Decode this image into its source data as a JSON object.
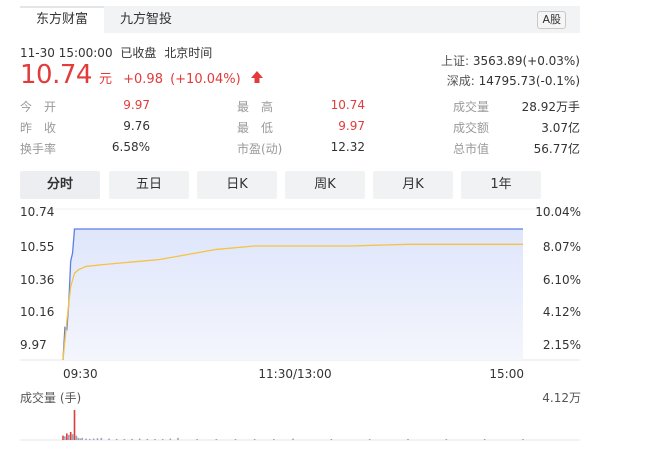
{
  "tabs": [
    {
      "label": "东方财富",
      "active": true
    },
    {
      "label": "九方智投",
      "active": false
    }
  ],
  "market_badge": "A股",
  "quote": {
    "timestamp": "11-30 15:00:00",
    "status": "已收盘",
    "timezone": "北京时间",
    "price": "10.74",
    "unit": "元",
    "change": "+0.98",
    "change_pct": "(+10.04%)"
  },
  "indices": [
    {
      "label": "上证:",
      "value": "3563.89(+0.03%)"
    },
    {
      "label": "深成:",
      "value": "14795.73(-0.1%)"
    }
  ],
  "stats": {
    "col1": [
      {
        "label": "今　开",
        "value": "9.97",
        "red": true
      },
      {
        "label": "昨　收",
        "value": "9.76",
        "red": false
      },
      {
        "label": "换手率",
        "value": "6.58%",
        "red": false
      }
    ],
    "col2": [
      {
        "label": "最　高",
        "value": "10.74",
        "red": true
      },
      {
        "label": "最　低",
        "value": "9.97",
        "red": true
      },
      {
        "label": "市盈(动)",
        "value": "12.32",
        "red": false
      }
    ],
    "col3": [
      {
        "label": "成交量",
        "value": "28.92万手"
      },
      {
        "label": "成交额",
        "value": "3.07亿"
      },
      {
        "label": "总市值",
        "value": "56.77亿"
      }
    ]
  },
  "period_buttons": [
    {
      "label": "分时",
      "active": true
    },
    {
      "label": "五日",
      "active": false
    },
    {
      "label": "日K",
      "active": false
    },
    {
      "label": "周K",
      "active": false
    },
    {
      "label": "月K",
      "active": false
    },
    {
      "label": "1年",
      "active": false
    }
  ],
  "colors": {
    "up": "#e23b3b",
    "price_line": "#5b7ee8",
    "avg_line": "#f5c342",
    "area": "#dfe6fb"
  },
  "chart_data": {
    "type": "line",
    "y_left_ticks": [
      "10.74",
      "10.55",
      "10.36",
      "10.16",
      "9.97"
    ],
    "y_right_ticks": [
      "10.04%",
      "8.07%",
      "6.10%",
      "4.12%",
      "2.15%"
    ],
    "x_ticks": [
      "09:30",
      "11:30/13:00",
      "15:00"
    ],
    "ylim": [
      9.97,
      10.74
    ],
    "series": [
      {
        "key": "price",
        "x": [
          0,
          1,
          2,
          3,
          4,
          5,
          6,
          8,
          240
        ],
        "values": [
          9.97,
          10.16,
          10.15,
          10.3,
          10.55,
          10.6,
          10.74,
          10.74,
          10.74
        ]
      },
      {
        "key": "avg",
        "x": [
          0,
          2,
          4,
          6,
          8,
          12,
          20,
          30,
          40,
          50,
          60,
          80,
          100,
          120,
          150,
          180,
          200,
          220,
          240
        ],
        "values": [
          9.97,
          10.2,
          10.4,
          10.48,
          10.5,
          10.52,
          10.53,
          10.54,
          10.55,
          10.56,
          10.58,
          10.62,
          10.64,
          10.64,
          10.64,
          10.65,
          10.65,
          10.65,
          10.65
        ]
      }
    ],
    "volume_label": "成交量 (手)",
    "volume_max_label": "4.12万",
    "volume_ymax": 4.12,
    "volume": {
      "x": [
        0,
        1,
        2,
        3,
        4,
        5,
        6,
        7,
        8,
        9,
        10,
        12,
        14,
        16,
        18,
        20,
        24,
        28,
        32,
        36,
        40,
        44,
        48,
        52,
        56,
        60,
        70,
        80,
        90,
        100,
        110,
        120,
        140,
        160,
        180,
        200,
        220,
        240
      ],
      "values": [
        0.6,
        0.5,
        0.9,
        0.7,
        1.1,
        0.8,
        4.12,
        0.6,
        0.3,
        0.2,
        0.3,
        0.2,
        0.15,
        0.2,
        0.25,
        0.3,
        0.2,
        0.15,
        0.1,
        0.15,
        0.2,
        0.15,
        0.1,
        0.1,
        0.2,
        0.3,
        0.1,
        0.05,
        0.1,
        0.05,
        0.05,
        0.2,
        0.05,
        0.05,
        0.05,
        0.05,
        0.05,
        0.05
      ],
      "up": [
        true,
        false,
        true,
        false,
        true,
        false,
        true,
        false,
        false,
        false,
        false,
        false,
        false,
        false,
        false,
        false,
        false,
        false,
        false,
        false,
        false,
        false,
        false,
        false,
        false,
        false,
        false,
        false,
        false,
        false,
        false,
        false,
        false,
        false,
        false,
        false,
        false,
        false
      ]
    }
  }
}
